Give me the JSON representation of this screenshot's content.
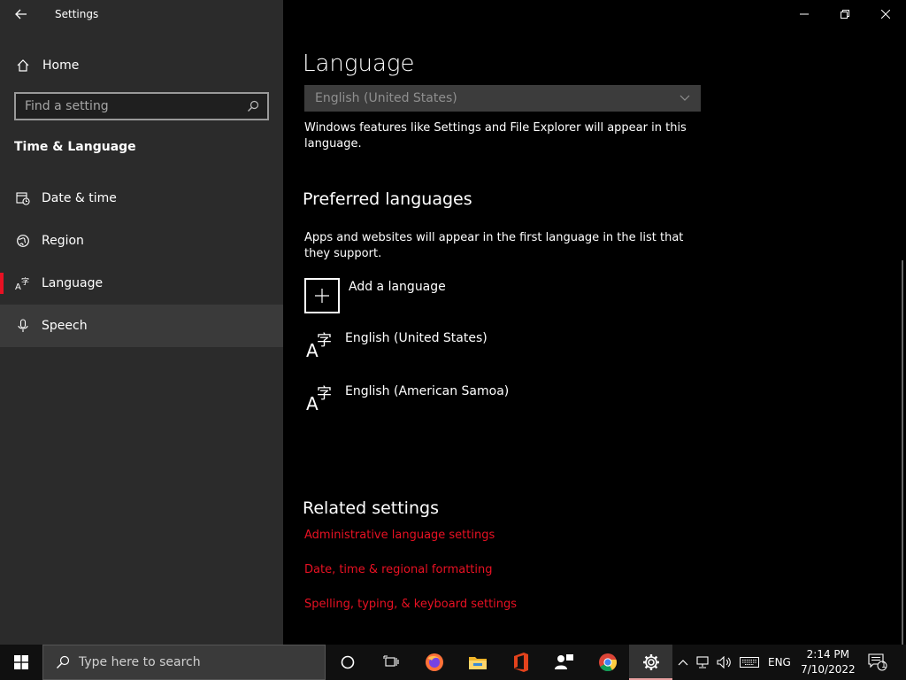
{
  "window": {
    "title": "Settings",
    "controls": [
      "minimize",
      "restore",
      "close"
    ]
  },
  "sidebar": {
    "home_label": "Home",
    "search_placeholder": "Find a setting",
    "section_title": "Time & Language",
    "items": [
      {
        "label": "Date & time",
        "icon": "clock-calendar-icon"
      },
      {
        "label": "Region",
        "icon": "globe-icon"
      },
      {
        "label": "Language",
        "icon": "language-icon",
        "selected": true
      },
      {
        "label": "Speech",
        "icon": "microphone-icon",
        "hover": true
      }
    ]
  },
  "main": {
    "page_title": "Language",
    "display_language_value": "English (United States)",
    "display_language_desc": "Windows features like Settings and File Explorer will appear in this language.",
    "preferred_title": "Preferred languages",
    "preferred_desc": "Apps and websites will appear in the first language in the list that they support.",
    "add_language_label": "Add a language",
    "languages": [
      {
        "label": "English (United States)"
      },
      {
        "label": "English (American Samoa)"
      }
    ],
    "related_title": "Related settings",
    "related_links": [
      {
        "label": "Administrative language settings"
      },
      {
        "label": "Date, time & regional formatting"
      },
      {
        "label": "Spelling, typing, & keyboard settings"
      }
    ]
  },
  "taskbar": {
    "search_placeholder": "Type here to search",
    "apps": [
      "cortana-icon",
      "task-view-icon",
      "firefox-icon",
      "file-explorer-icon",
      "office-icon",
      "people-icon",
      "chrome-icon",
      "settings-icon"
    ],
    "input_language": "ENG",
    "time": "2:14 PM",
    "date": "7/10/2022",
    "notification_count": "1"
  },
  "colors": {
    "accent": "#e81123",
    "sidebar_bg": "#2b2b2b",
    "main_bg": "#000000",
    "taskbar_bg": "#101010"
  }
}
